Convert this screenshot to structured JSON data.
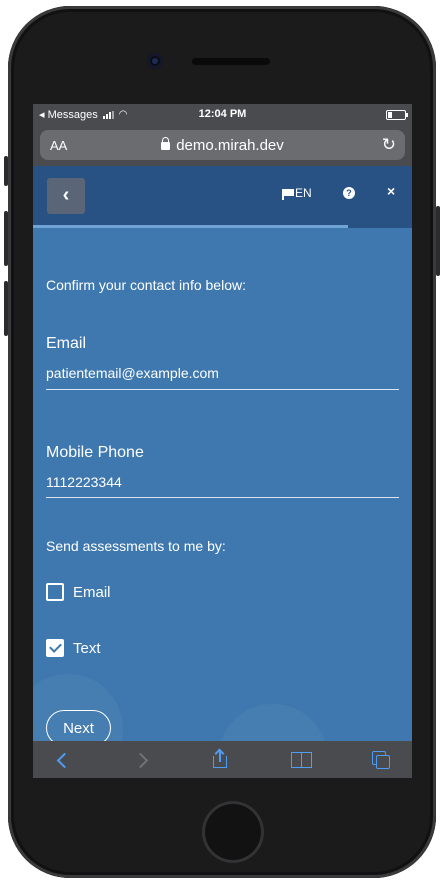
{
  "status_bar": {
    "back_app": "◂ Messages",
    "time": "12:04 PM"
  },
  "browser": {
    "aa_label": "AA",
    "url": "demo.mirah.dev"
  },
  "header": {
    "back_glyph": "‹",
    "language": "EN",
    "help_glyph": "?",
    "close_glyph": "×",
    "progress_fraction": 0.83
  },
  "form": {
    "intro": "Confirm your contact info below:",
    "email_label": "Email",
    "email_value": "patientemail@example.com",
    "phone_label": "Mobile Phone",
    "phone_value": "1112223344",
    "send_label": "Send assessments to me by:",
    "options": [
      {
        "label": "Email",
        "checked": false
      },
      {
        "label": "Text",
        "checked": true
      }
    ],
    "next_label": "Next"
  },
  "colors": {
    "screen_bg": "#3e78ae",
    "header_bg": "#275283",
    "ios_accent": "#4f9cf5"
  },
  "icons": [
    "lock-icon",
    "reload-icon",
    "flag-icon",
    "help-icon",
    "close-icon",
    "back-chevron-icon",
    "forward-chevron-icon",
    "share-icon",
    "bookmarks-icon",
    "tabs-icon"
  ]
}
